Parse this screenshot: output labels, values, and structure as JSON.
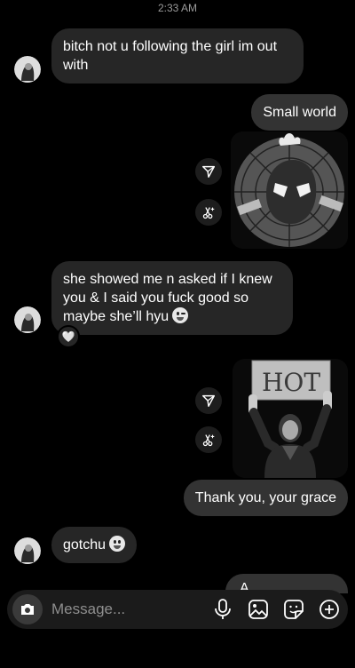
{
  "status_time": "2:33 AM",
  "messages": [
    {
      "id": "m1",
      "direction": "incoming",
      "text": "bitch not u following the girl im out with"
    },
    {
      "id": "m2",
      "direction": "outgoing",
      "text": "Small world"
    },
    {
      "id": "m3",
      "direction": "outgoing",
      "type": "image",
      "description_icon": "spiderman-image"
    },
    {
      "id": "m4",
      "direction": "incoming",
      "text": "she showed me n asked if I knew you & I said you fuck good so maybe she’ll hyu",
      "emoji": "winking-face",
      "reaction": "🤍"
    },
    {
      "id": "m5",
      "direction": "outgoing",
      "type": "image",
      "sign_text": "HOT"
    },
    {
      "id": "m6",
      "direction": "outgoing",
      "text": "Thank you, your grace"
    },
    {
      "id": "m7",
      "direction": "incoming",
      "text": "gotchu",
      "emoji": "tongue-face"
    },
    {
      "id": "m8",
      "direction": "outgoing",
      "text": "A..."
    }
  ],
  "composer": {
    "placeholder": "Message...",
    "icons": [
      "camera-icon",
      "microphone-icon",
      "gallery-icon",
      "sticker-icon",
      "add-icon"
    ]
  },
  "colors": {
    "background": "#000000",
    "incoming_bubble": "#262626",
    "outgoing_bubble": "#333333",
    "composer": "#1b1b1b"
  }
}
